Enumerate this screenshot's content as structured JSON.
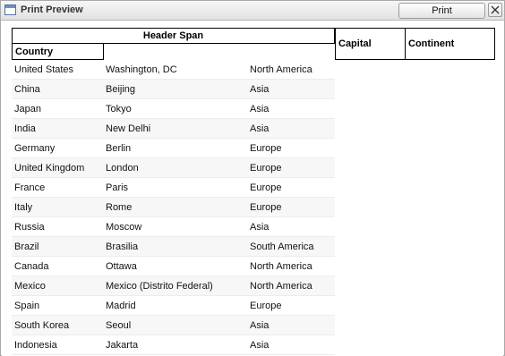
{
  "window": {
    "title": "Print Preview",
    "print_label": "Print"
  },
  "table": {
    "header_span": "Header Span",
    "col_country": "Country",
    "col_capital": "Capital",
    "col_continent": "Continent",
    "rows": [
      {
        "country": "United States",
        "capital": "Washington, DC",
        "continent": "North America"
      },
      {
        "country": "China",
        "capital": "Beijing",
        "continent": "Asia"
      },
      {
        "country": "Japan",
        "capital": "Tokyo",
        "continent": "Asia"
      },
      {
        "country": "India",
        "capital": "New Delhi",
        "continent": "Asia"
      },
      {
        "country": "Germany",
        "capital": "Berlin",
        "continent": "Europe"
      },
      {
        "country": "United Kingdom",
        "capital": "London",
        "continent": "Europe"
      },
      {
        "country": "France",
        "capital": "Paris",
        "continent": "Europe"
      },
      {
        "country": "Italy",
        "capital": "Rome",
        "continent": "Europe"
      },
      {
        "country": "Russia",
        "capital": "Moscow",
        "continent": "Asia"
      },
      {
        "country": "Brazil",
        "capital": "Brasilia",
        "continent": "South America"
      },
      {
        "country": "Canada",
        "capital": "Ottawa",
        "continent": "North America"
      },
      {
        "country": "Mexico",
        "capital": "Mexico (Distrito Federal)",
        "continent": "North America"
      },
      {
        "country": "Spain",
        "capital": "Madrid",
        "continent": "Europe"
      },
      {
        "country": "South Korea",
        "capital": "Seoul",
        "continent": "Asia"
      },
      {
        "country": "Indonesia",
        "capital": "Jakarta",
        "continent": "Asia"
      }
    ]
  }
}
